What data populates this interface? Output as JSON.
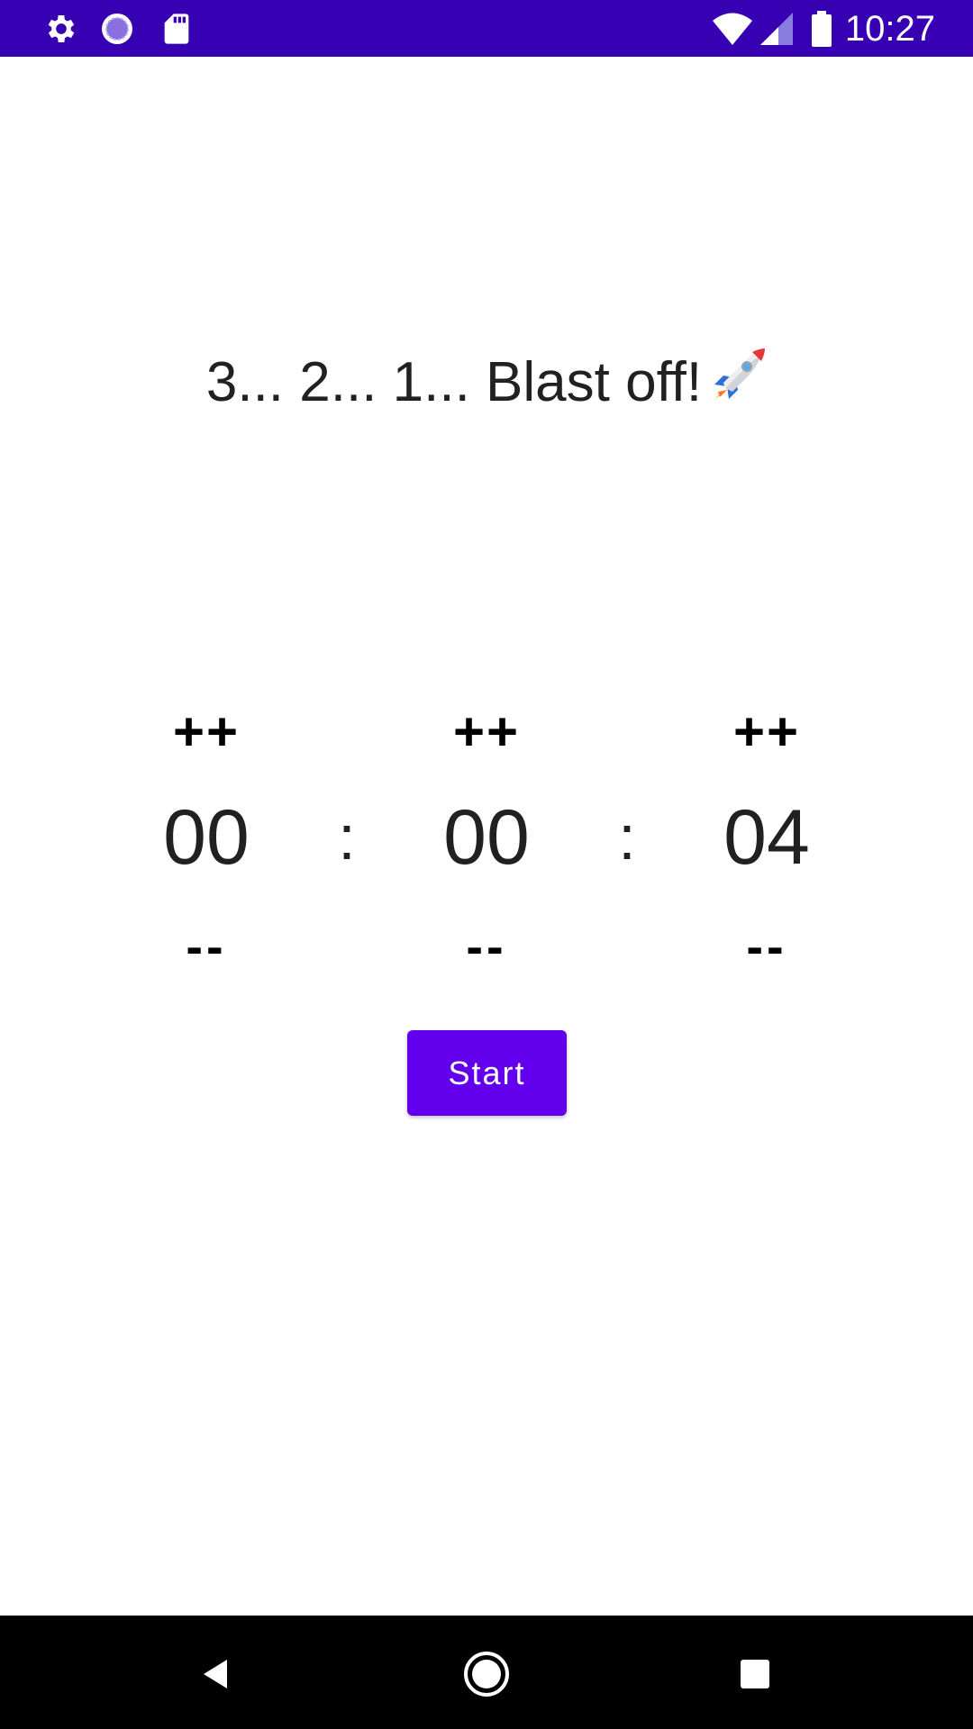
{
  "status_bar": {
    "time": "10:27",
    "icons": [
      "settings-icon",
      "sync-icon",
      "sd-card-icon",
      "wifi-icon",
      "signal-icon",
      "battery-icon"
    ]
  },
  "app": {
    "title": "3... 2... 1... Blast off!",
    "title_icon": "rocket-icon"
  },
  "timer": {
    "hours": {
      "increment_label": "++",
      "value": "00",
      "decrement_label": "--"
    },
    "minutes": {
      "increment_label": "++",
      "value": "00",
      "decrement_label": "--"
    },
    "seconds": {
      "increment_label": "++",
      "value": "04",
      "decrement_label": "--"
    },
    "separator": ":"
  },
  "start_button": {
    "label": "Start"
  },
  "nav_bar": {
    "icons": [
      "back-icon",
      "home-icon",
      "recents-icon"
    ]
  },
  "colors": {
    "status_bar": "#3700b3",
    "accent": "#6200ee",
    "text": "#212121",
    "nav_bar": "#000000"
  }
}
